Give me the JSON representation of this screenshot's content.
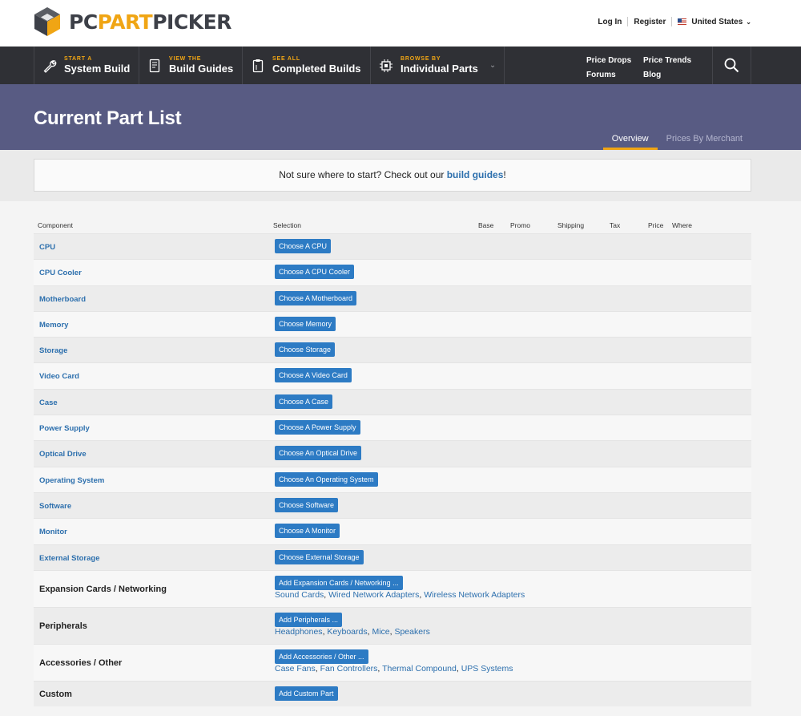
{
  "brand": {
    "logo_a": "PC",
    "logo_b": "PART",
    "logo_c": "PICKER"
  },
  "top_links": {
    "login": "Log In",
    "register": "Register",
    "country": "United States"
  },
  "nav": {
    "items": [
      {
        "small": "START A",
        "big": "System Build",
        "icon": "wrench-icon"
      },
      {
        "small": "VIEW THE",
        "big": "Build Guides",
        "icon": "book-icon"
      },
      {
        "small": "SEE ALL",
        "big": "Completed Builds",
        "icon": "clipboard-icon"
      },
      {
        "small": "BROWSE BY",
        "big": "Individual Parts",
        "icon": "chip-icon"
      }
    ],
    "links": [
      "Price Drops",
      "Price Trends",
      "Forums",
      "Blog"
    ]
  },
  "hero": {
    "title": "Current Part List",
    "tabs": [
      "Overview",
      "Prices By Merchant"
    ]
  },
  "notice": {
    "text": "Not sure where to start? Check out our ",
    "link": "build guides",
    "end": "!"
  },
  "table": {
    "headers": [
      "Component",
      "Selection",
      "Base",
      "Promo",
      "Shipping",
      "Tax",
      "Price",
      "Where"
    ],
    "rows": [
      {
        "component": "CPU",
        "button": "Choose A CPU"
      },
      {
        "component": "CPU Cooler",
        "button": "Choose A CPU Cooler"
      },
      {
        "component": "Motherboard",
        "button": "Choose A Motherboard"
      },
      {
        "component": "Memory",
        "button": "Choose Memory"
      },
      {
        "component": "Storage",
        "button": "Choose Storage"
      },
      {
        "component": "Video Card",
        "button": "Choose A Video Card"
      },
      {
        "component": "Case",
        "button": "Choose A Case"
      },
      {
        "component": "Power Supply",
        "button": "Choose A Power Supply"
      },
      {
        "component": "Optical Drive",
        "button": "Choose An Optical Drive"
      },
      {
        "component": "Operating System",
        "button": "Choose An Operating System"
      },
      {
        "component": "Software",
        "button": "Choose Software"
      },
      {
        "component": "Monitor",
        "button": "Choose A Monitor"
      },
      {
        "component": "External Storage",
        "button": "Choose External Storage"
      }
    ],
    "extra_rows": [
      {
        "component": "Expansion Cards / Networking",
        "button": "Add Expansion Cards / Networking ...",
        "links": [
          "Sound Cards",
          "Wired Network Adapters",
          "Wireless Network Adapters"
        ]
      },
      {
        "component": "Peripherals",
        "button": "Add Peripherals ...",
        "links": [
          "Headphones",
          "Keyboards",
          "Mice",
          "Speakers"
        ]
      },
      {
        "component": "Accessories / Other",
        "button": "Add Accessories / Other ...",
        "links": [
          "Case Fans",
          "Fan Controllers",
          "Thermal Compound",
          "UPS Systems"
        ]
      }
    ],
    "custom_row": {
      "component": "Custom",
      "button": "Add Custom Part"
    }
  },
  "colors": {
    "accent": "#f0a514",
    "link": "#2c6fad",
    "button": "#2d7bc4",
    "hero": "#585b83",
    "nav": "#2f3035"
  }
}
